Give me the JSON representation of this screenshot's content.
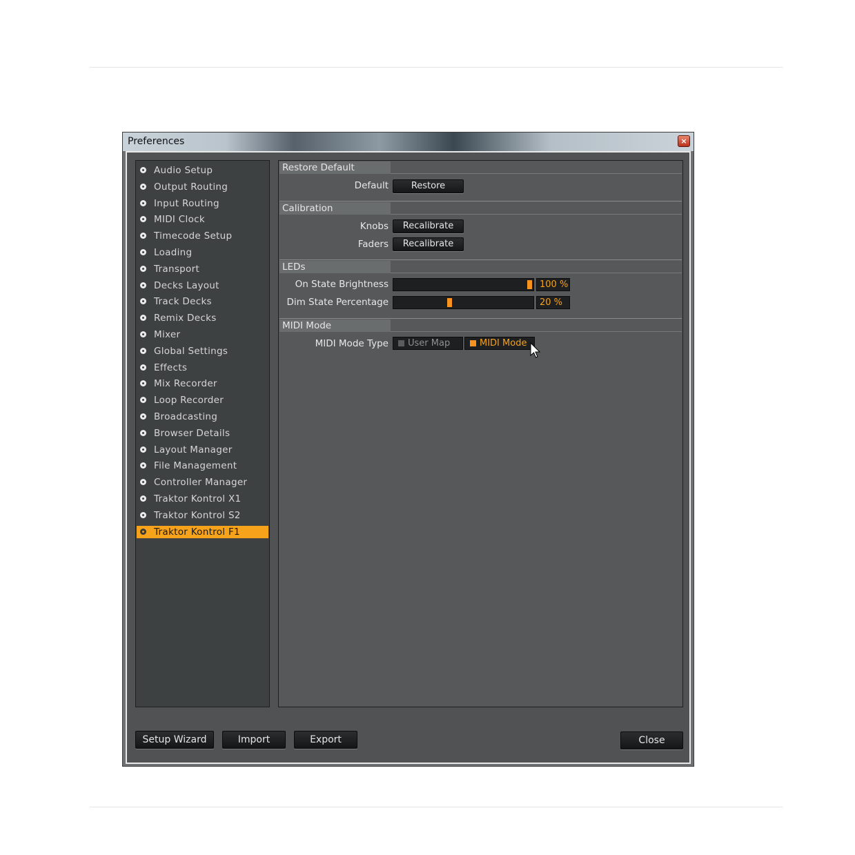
{
  "window": {
    "title": "Preferences",
    "close_glyph": "×"
  },
  "sidebar": {
    "items": [
      {
        "label": "Audio Setup"
      },
      {
        "label": "Output Routing"
      },
      {
        "label": "Input Routing"
      },
      {
        "label": "MIDI Clock"
      },
      {
        "label": "Timecode Setup"
      },
      {
        "label": "Loading"
      },
      {
        "label": "Transport"
      },
      {
        "label": "Decks Layout"
      },
      {
        "label": "Track Decks"
      },
      {
        "label": "Remix Decks"
      },
      {
        "label": "Mixer"
      },
      {
        "label": "Global Settings"
      },
      {
        "label": "Effects"
      },
      {
        "label": "Mix Recorder"
      },
      {
        "label": "Loop Recorder"
      },
      {
        "label": "Broadcasting"
      },
      {
        "label": "Browser Details"
      },
      {
        "label": "Layout Manager"
      },
      {
        "label": "File Management"
      },
      {
        "label": "Controller Manager"
      },
      {
        "label": "Traktor Kontrol X1"
      },
      {
        "label": "Traktor Kontrol S2"
      },
      {
        "label": "Traktor Kontrol F1"
      }
    ],
    "selected": "Traktor Kontrol F1"
  },
  "sections": {
    "restore_default": {
      "header": "Restore Default",
      "default_label": "Default",
      "restore_button": "Restore"
    },
    "calibration": {
      "header": "Calibration",
      "knobs_label": "Knobs",
      "faders_label": "Faders",
      "recalibrate_button": "Recalibrate"
    },
    "leds": {
      "header": "LEDs",
      "on_state_label": "On State Brightness",
      "on_state_value": "100 %",
      "on_state_level": 100,
      "dim_state_label": "Dim State Percentage",
      "dim_state_value": "20 %",
      "dim_state_level": 40
    },
    "midi_mode": {
      "header": "MIDI Mode",
      "type_label": "MIDI Mode Type",
      "option_user_map": "User Map",
      "option_midi_mode": "MIDI Mode",
      "selected": "MIDI Mode"
    }
  },
  "footer": {
    "setup_wizard": "Setup Wizard",
    "import": "Import",
    "export": "Export",
    "close": "Close"
  },
  "colors": {
    "accent": "#f7a21b",
    "panel": "#565859",
    "sidebar": "#3e4142"
  }
}
